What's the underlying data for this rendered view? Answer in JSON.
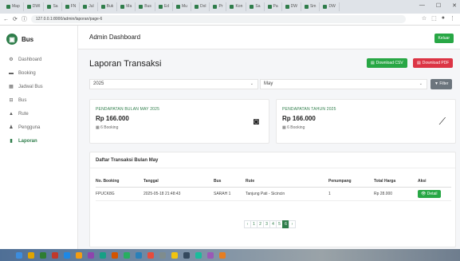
{
  "browser": {
    "tabs": [
      "Map",
      "DWI",
      "Sa",
      "FN",
      "Jul",
      "Buk",
      "Ma",
      "Bus",
      "Ed",
      "Mu",
      "Dol",
      "Pr",
      "Kon",
      "Sa",
      "Pa",
      "DW",
      "Sm",
      "DW"
    ],
    "active_tab": "",
    "url": "127.0.0.1:8000/admin/laporan/page-6",
    "window_controls": [
      "—",
      "☐",
      "✕"
    ]
  },
  "sidebar": {
    "brand": "Bus",
    "items": [
      {
        "label": "Dashboard",
        "icon": "gauge-icon",
        "glyph": "⚙"
      },
      {
        "label": "Booking",
        "icon": "bus-icon",
        "glyph": "▬"
      },
      {
        "label": "Jadwal Bus",
        "icon": "calendar-icon",
        "glyph": "▦"
      },
      {
        "label": "Bus",
        "icon": "bus-icon",
        "glyph": "⊟"
      },
      {
        "label": "Rute",
        "icon": "road-icon",
        "glyph": "▲"
      },
      {
        "label": "Pengguna",
        "icon": "users-icon",
        "glyph": "♟"
      },
      {
        "label": "Laporan",
        "icon": "file-icon",
        "glyph": "▮",
        "active": true
      }
    ]
  },
  "header": {
    "title": "Admin Dashboard",
    "logout_label": "Keluar"
  },
  "page": {
    "title": "Laporan Transaksi",
    "download_csv": "Download CSV",
    "download_pdf": "Download PDF"
  },
  "filters": {
    "year": "2025",
    "month": "May",
    "filter_label": "Filter"
  },
  "stats": [
    {
      "label": "PENDAPATAN BULAN MAY 2025",
      "value": "Rp 166.000",
      "sub": "6 Booking",
      "icon": "money-icon"
    },
    {
      "label": "PENDAPATAN TAHUN 2025",
      "value": "Rp 166.000",
      "sub": "6 Booking",
      "icon": "chart-line-icon"
    }
  ],
  "table": {
    "title": "Daftar Transaksi Bulan May",
    "columns": [
      "No. Booking",
      "Tanggal",
      "Bus",
      "Rute",
      "Penumpang",
      "Total Harga",
      "Aksi"
    ],
    "rows": [
      [
        "FPUCK8G",
        "2025-05-18 21:48:43",
        "SARAH 1",
        "Tanjung Pati - Sicincin",
        "1",
        "Rp 28.000",
        "Detail"
      ]
    ]
  },
  "pagination": {
    "prev": "‹",
    "pages": [
      "1",
      "2",
      "3",
      "4",
      "5",
      "6"
    ],
    "active": "6",
    "next": "›"
  }
}
